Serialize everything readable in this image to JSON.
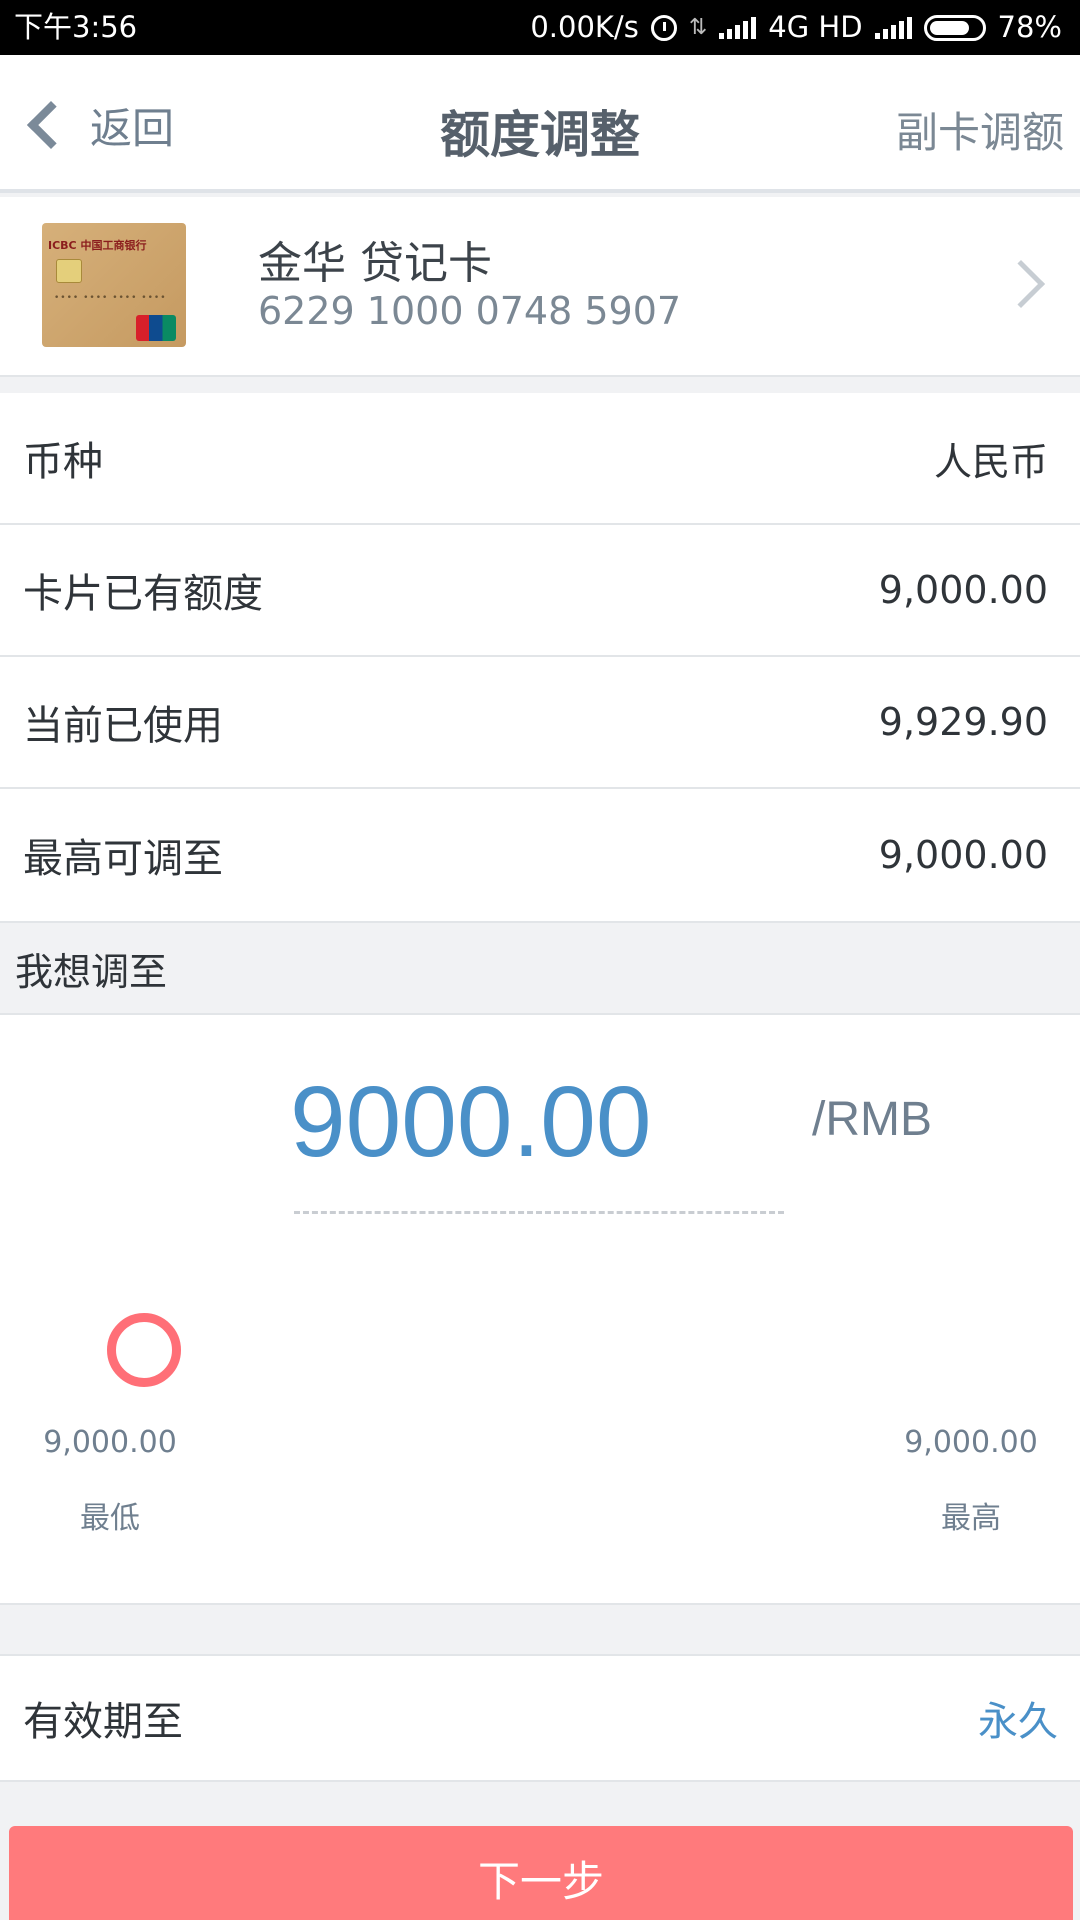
{
  "status_bar": {
    "time": "下午3:56",
    "net_speed": "0.00K/s",
    "network": "4G HD",
    "battery": "78%",
    "battery_level": 0.78
  },
  "header": {
    "back_label": "返回",
    "title": "额度调整",
    "right_action": "副卡调额"
  },
  "card": {
    "name": "金华 贷记卡",
    "number": "6229 1000 0748 5907",
    "image_bank_text": "ICBC 中国工商银行",
    "image_brand_text": "UnionPay 银联"
  },
  "info_rows": [
    {
      "label": "币种",
      "value": "人民币"
    },
    {
      "label": "卡片已有额度",
      "value": "9,000.00"
    },
    {
      "label": "当前已使用",
      "value": "9,929.90"
    },
    {
      "label": "最高可调至",
      "value": "9,000.00"
    }
  ],
  "target_section": {
    "label": "我想调至",
    "amount": "9000.00",
    "unit": "/RMB",
    "slider_level": 0,
    "min_value": "9,000.00",
    "min_label": "最低",
    "max_value": "9,000.00",
    "max_label": "最高"
  },
  "validity": {
    "label": "有效期至",
    "value": "永久"
  },
  "next_button": "下一步",
  "colors": {
    "accent_blue": "#4a90c8",
    "button_red": "#ff7a7c",
    "knob_red": "#ff6f77",
    "status_bar": "#000000"
  }
}
